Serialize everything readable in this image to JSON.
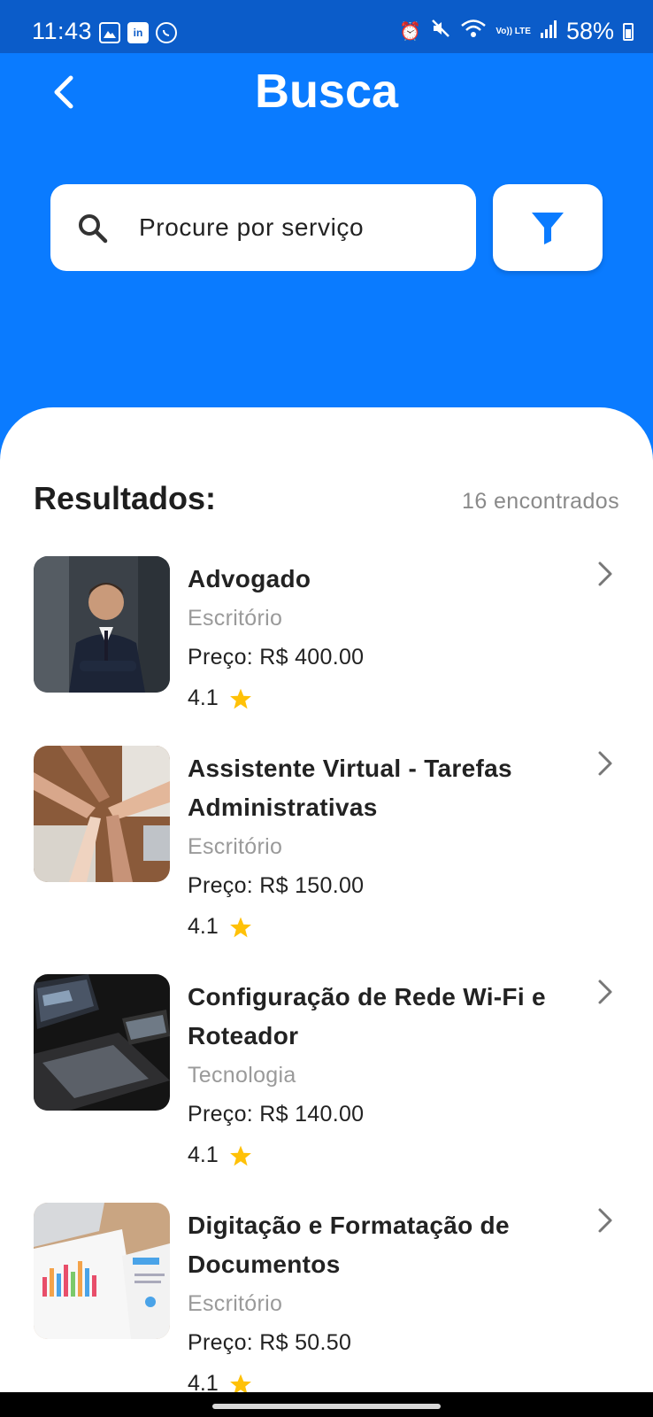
{
  "status_bar": {
    "time": "11:43",
    "battery": "58%",
    "volte": "Vo)) LTE",
    "left_icons": [
      "gallery-icon",
      "linkedin-icon",
      "whatsapp-icon"
    ],
    "right_icons": [
      "alarm-icon",
      "mute-icon",
      "wifi-icon",
      "volte-icon",
      "signal-icon",
      "battery-icon"
    ]
  },
  "header": {
    "title": "Busca",
    "back_icon": "chevron-left-icon"
  },
  "search": {
    "placeholder": "Procure por serviço",
    "icon": "search-icon",
    "filter_icon": "filter-icon"
  },
  "results": {
    "heading": "Resultados:",
    "count_text": "16 encontrados",
    "items": [
      {
        "title": "Advogado",
        "category": "Escritório",
        "price": "Preço: R$ 400.00",
        "rating": "4.1",
        "image": "lawyer-photo"
      },
      {
        "title": "Assistente Virtual - Tarefas Administrativas",
        "category": "Escritório",
        "price": "Preço: R$ 150.00",
        "rating": "4.1",
        "image": "team-hands-photo"
      },
      {
        "title": "Configuração de Rede Wi-Fi e Roteador",
        "category": "Tecnologia",
        "price": "Preço: R$ 140.00",
        "rating": "4.1",
        "image": "devices-photo"
      },
      {
        "title": "Digitação e Formatação de Documentos",
        "category": "Escritório",
        "price": "Preço: R$ 50.50",
        "rating": "4.1",
        "image": "documents-photo"
      }
    ]
  },
  "colors": {
    "primary": "#0A7BFF",
    "status_bar": "#0B5CC9",
    "star": "#FFC107",
    "muted_text": "#9A9A9A"
  }
}
